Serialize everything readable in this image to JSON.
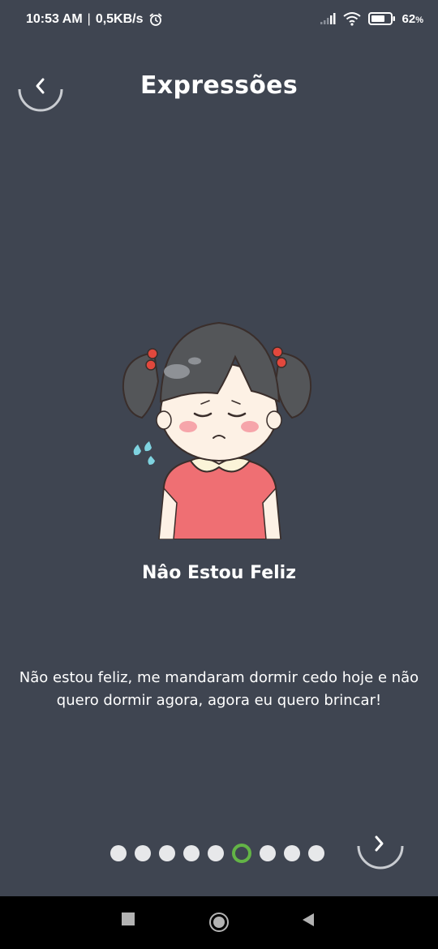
{
  "status_bar": {
    "time": "10:53 AM",
    "separator": "|",
    "network_speed": "0,5KB/s",
    "battery_percent": "62",
    "battery_unit": "%",
    "battery_level": 0.62,
    "icons": [
      "alarm-icon",
      "signal-icon",
      "wifi-icon",
      "battery-icon"
    ]
  },
  "header": {
    "title": "Expressões",
    "back_icon": "chevron-left-icon"
  },
  "expression": {
    "title": "Nâo Estou Feliz",
    "description": "Não estou feliz, me mandaram dormir cedo hoje e não quero dormir agora, agora eu quero brincar!",
    "illustration": "sad-girl-illustration"
  },
  "pager": {
    "total": 9,
    "current": 6,
    "next_icon": "chevron-right-icon"
  },
  "navigation_bar": {
    "icons": [
      "recent-apps-icon",
      "home-icon",
      "back-icon"
    ]
  },
  "colors": {
    "background": "#3f4551",
    "dot_inactive": "#e7e8ea",
    "dot_active": "#63b446",
    "nav_bar": "#000000"
  }
}
